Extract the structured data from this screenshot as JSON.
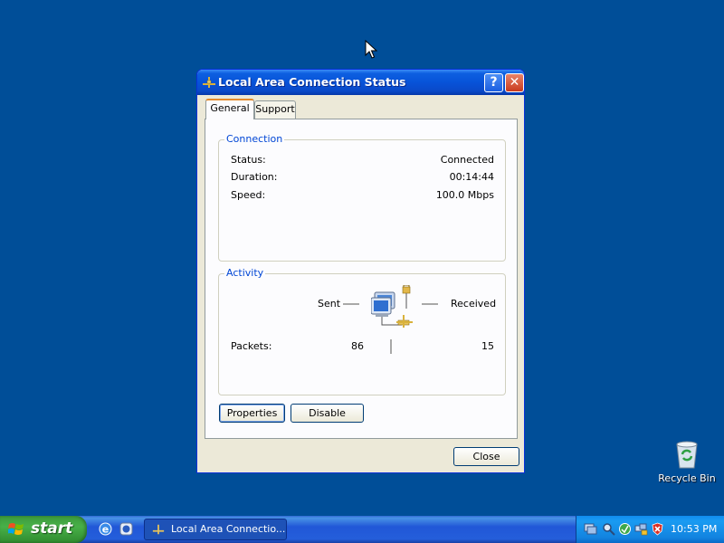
{
  "dialog": {
    "title": "Local Area Connection Status",
    "help_button": "?",
    "close_button_glyph": "✕",
    "tabs": [
      {
        "label": "General",
        "active": true
      },
      {
        "label": "Support",
        "active": false
      }
    ],
    "connection": {
      "group_label": "Connection",
      "rows": [
        {
          "label": "Status:",
          "value": "Connected"
        },
        {
          "label": "Duration:",
          "value": "00:14:44"
        },
        {
          "label": "Speed:",
          "value": "100.0 Mbps"
        }
      ]
    },
    "activity": {
      "group_label": "Activity",
      "sent_label": "Sent",
      "received_label": "Received",
      "packets_label": "Packets:",
      "packets_sent": "86",
      "packets_received": "15"
    },
    "buttons": {
      "properties": "Properties",
      "disable": "Disable",
      "close": "Close"
    }
  },
  "desktop": {
    "recycle_bin_label": "Recycle Bin"
  },
  "taskbar": {
    "start_label": "start",
    "quick_launch": [
      "internet-explorer-icon",
      "windows-media-icon"
    ],
    "task_button_label": "Local Area Connectio...",
    "tray_icons": [
      "network-monitor-icon",
      "search-tray-icon",
      "update-tray-icon",
      "network-connection-icon",
      "security-alert-icon"
    ],
    "clock": "10:53 PM"
  },
  "colors": {
    "desktop": "#004e98",
    "titlebar": "#0753d9",
    "group_label": "#0046d5",
    "start_button": "#48b048"
  }
}
